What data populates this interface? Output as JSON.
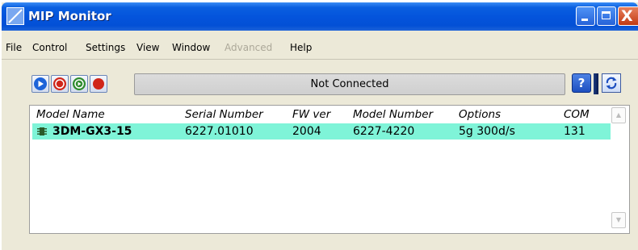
{
  "window": {
    "title": "MIP Monitor",
    "icon": "mip-monitor-app-icon"
  },
  "window_controls": {
    "minimize": "minimize-icon",
    "maximize": "maximize-icon",
    "close": "close-icon",
    "close_glyph": "X"
  },
  "menu": {
    "items": [
      {
        "label": "File",
        "enabled": true
      },
      {
        "label": "Control",
        "enabled": true
      },
      {
        "label": "Settings",
        "enabled": true
      },
      {
        "label": "View",
        "enabled": true
      },
      {
        "label": "Window",
        "enabled": true
      },
      {
        "label": "Advanced",
        "enabled": false
      },
      {
        "label": "Help",
        "enabled": true
      }
    ]
  },
  "toolbar": {
    "buttons": [
      {
        "icon": "play-icon",
        "color": "#1d63d8"
      },
      {
        "icon": "stop-icon",
        "color": "#d0261a"
      },
      {
        "icon": "record-stream-icon",
        "color": "#2e8b2e"
      },
      {
        "icon": "record-icon",
        "color": "#d0261a"
      }
    ],
    "status_text": "Not Connected",
    "help_label": "?",
    "refresh_icon": "refresh-icon"
  },
  "device_list": {
    "columns": [
      "Model Name",
      "Serial Number",
      "FW ver",
      "Model Number",
      "Options",
      "COM"
    ],
    "rows": [
      {
        "icon": "device-chip-icon",
        "model_name": "3DM-GX3-15",
        "serial_number": "6227.01010",
        "fw_ver": "2004",
        "model_number": "6227-4220",
        "options": "5g 300d/s",
        "com": "131",
        "highlight_color": "#7ff4d8"
      }
    ]
  }
}
